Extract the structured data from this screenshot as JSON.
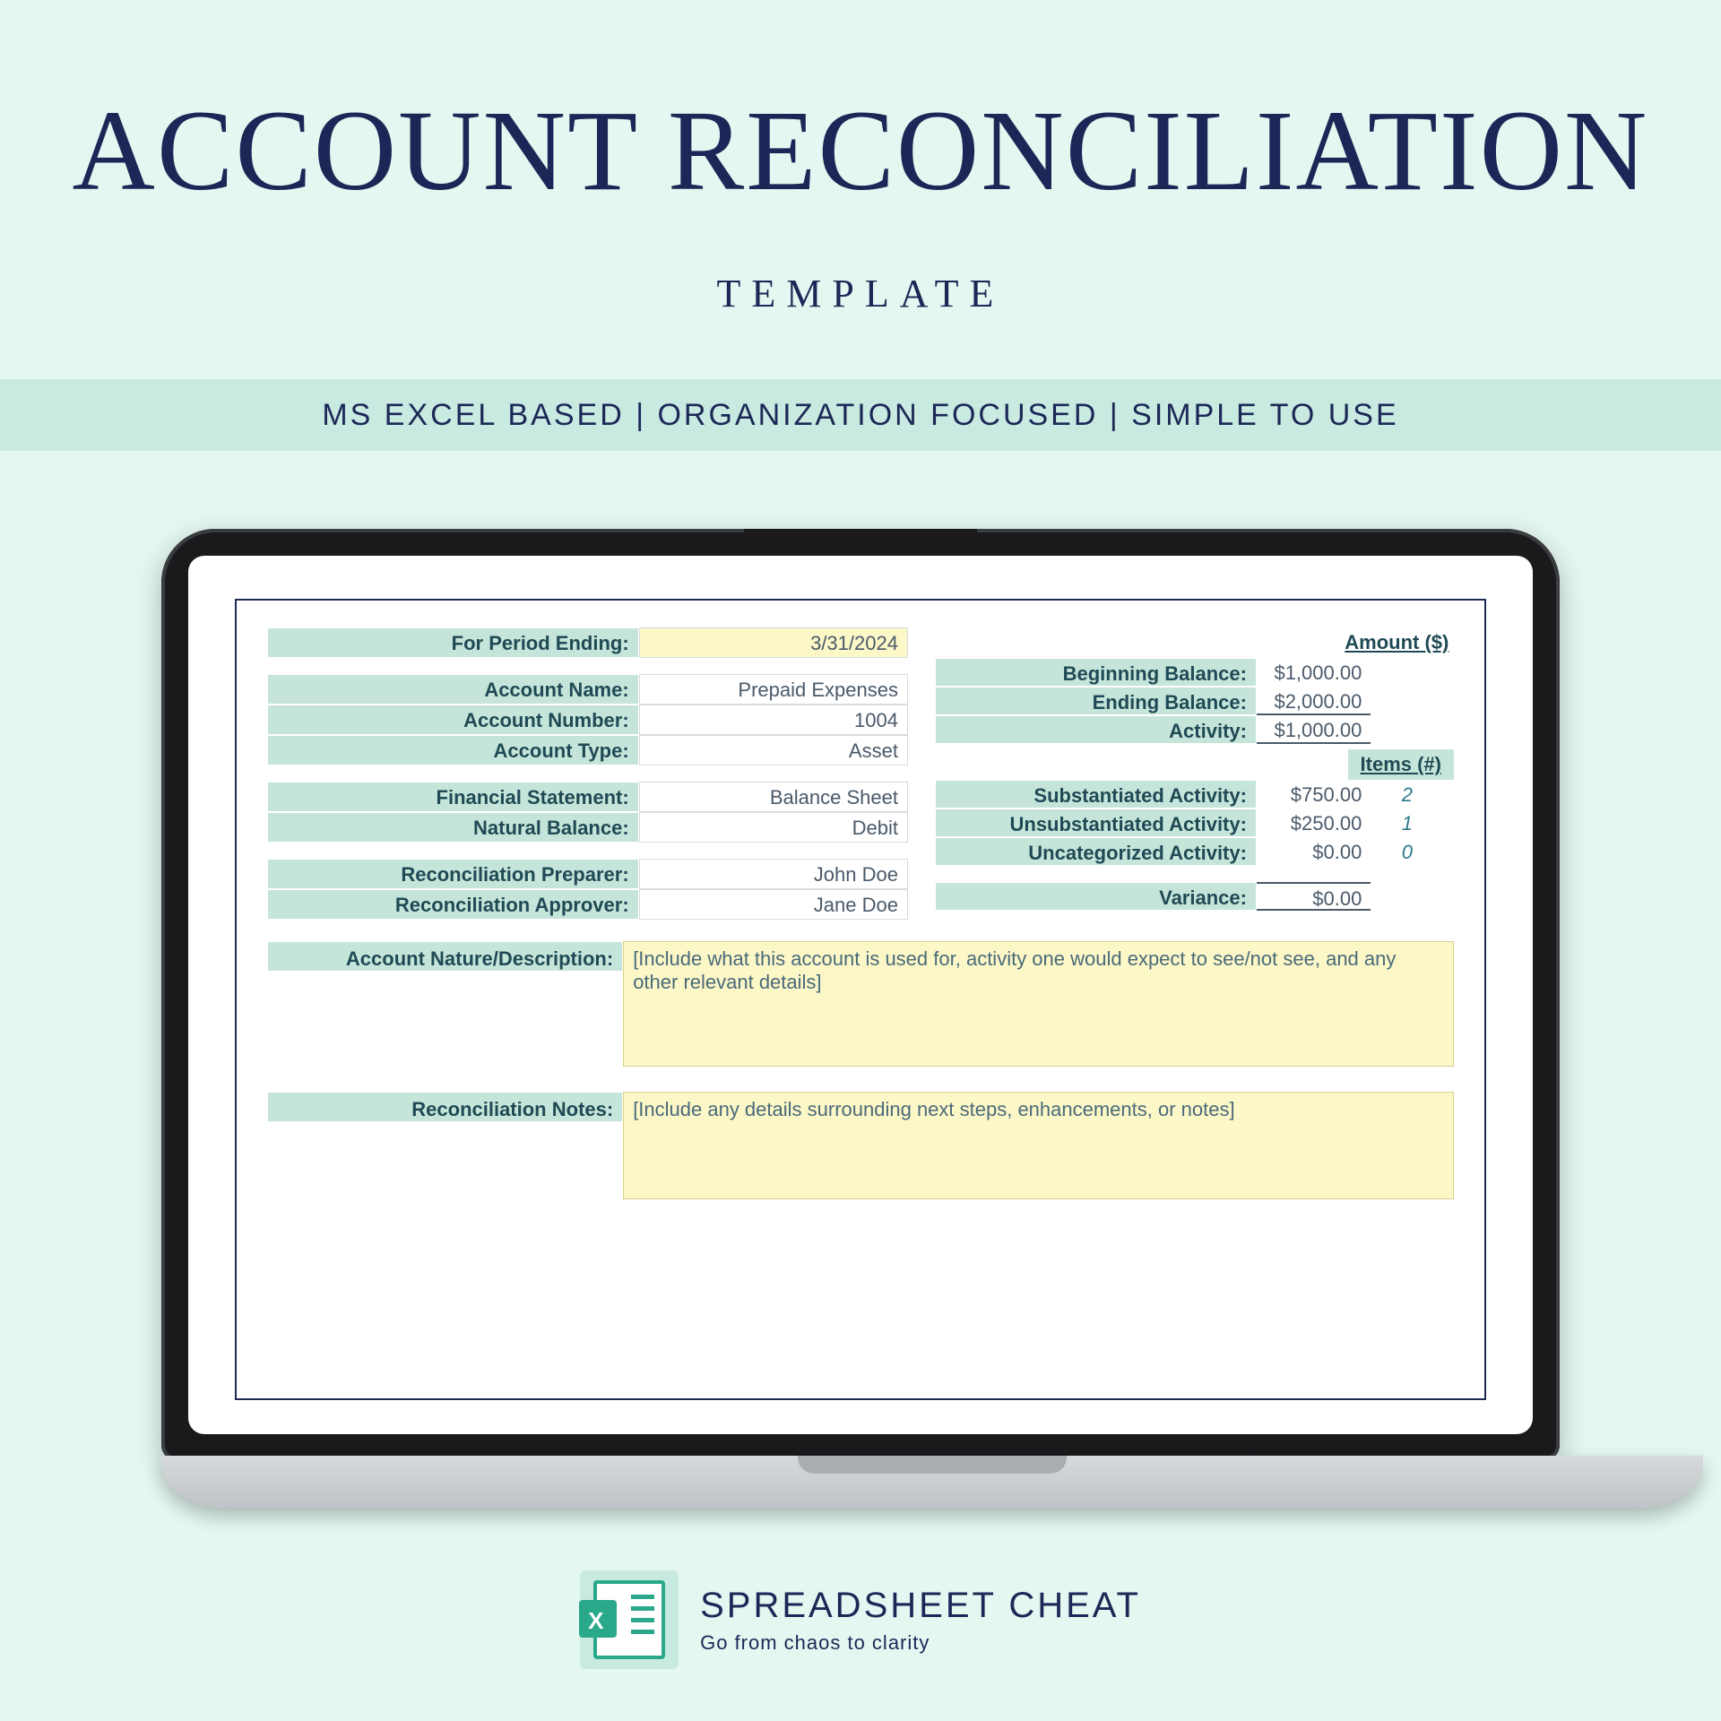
{
  "header": {
    "title": "ACCOUNT RECONCILIATION",
    "subtitle": "TEMPLATE",
    "band": "MS EXCEL BASED  |  ORGANIZATION FOCUSED  |  SIMPLE TO USE"
  },
  "left_fields": {
    "period_label": "For Period Ending:",
    "period_value": "3/31/2024",
    "acct_name_label": "Account Name:",
    "acct_name_value": "Prepaid Expenses",
    "acct_num_label": "Account Number:",
    "acct_num_value": "1004",
    "acct_type_label": "Account Type:",
    "acct_type_value": "Asset",
    "fs_label": "Financial Statement:",
    "fs_value": "Balance Sheet",
    "nb_label": "Natural Balance:",
    "nb_value": "Debit",
    "prep_label": "Reconciliation Preparer:",
    "prep_value": "John Doe",
    "appr_label": "Reconciliation Approver:",
    "appr_value": "Jane Doe"
  },
  "right_fields": {
    "amount_header": "Amount ($)",
    "items_header": "Items (#)",
    "beg_label": "Beginning Balance:",
    "beg_value": "$1,000.00",
    "end_label": "Ending Balance:",
    "end_value": "$2,000.00",
    "act_label": "Activity:",
    "act_value": "$1,000.00",
    "sub_label": "Substantiated Activity:",
    "sub_value": "$750.00",
    "sub_count": "2",
    "unsub_label": "Unsubstantiated Activity:",
    "unsub_value": "$250.00",
    "unsub_count": "1",
    "uncat_label": "Uncategorized Activity:",
    "uncat_value": "$0.00",
    "uncat_count": "0",
    "var_label": "Variance:",
    "var_value": "$0.00"
  },
  "blocks": {
    "desc_label": "Account Nature/Description:",
    "desc_text": "[Include what this account is used for, activity one would expect to see/not see, and any other relevant details]",
    "notes_label": "Reconciliation Notes:",
    "notes_text": "[Include any details surrounding next steps, enhancements, or notes]"
  },
  "footer": {
    "brand": "SPREADSHEET CHEAT",
    "tag": "Go from chaos to clarity"
  }
}
